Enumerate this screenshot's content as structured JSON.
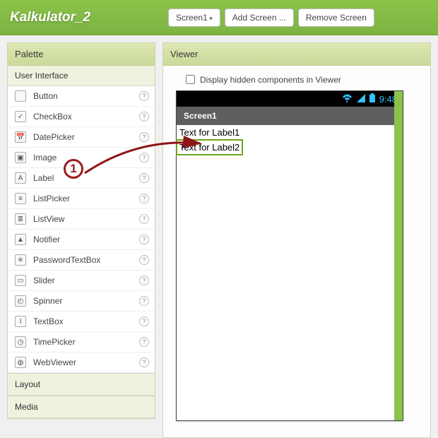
{
  "topbar": {
    "app_title": "Kalkulator_2",
    "screen_btn": "Screen1",
    "add_screen": "Add Screen ...",
    "remove_screen": "Remove Screen"
  },
  "palette": {
    "header": "Palette",
    "ui_header": "User Interface",
    "items": [
      {
        "label": "Button",
        "glyph": ""
      },
      {
        "label": "CheckBox",
        "glyph": "✓"
      },
      {
        "label": "DatePicker",
        "glyph": "📅"
      },
      {
        "label": "Image",
        "glyph": "▣"
      },
      {
        "label": "Label",
        "glyph": "A"
      },
      {
        "label": "ListPicker",
        "glyph": "≡"
      },
      {
        "label": "ListView",
        "glyph": "≣"
      },
      {
        "label": "Notifier",
        "glyph": "▲"
      },
      {
        "label": "PasswordTextBox",
        "glyph": "✳"
      },
      {
        "label": "Slider",
        "glyph": "▭"
      },
      {
        "label": "Spinner",
        "glyph": "◴"
      },
      {
        "label": "TextBox",
        "glyph": "I"
      },
      {
        "label": "TimePicker",
        "glyph": "◷"
      },
      {
        "label": "WebViewer",
        "glyph": "◍"
      }
    ],
    "layout_header": "Layout",
    "media_header": "Media"
  },
  "viewer": {
    "header": "Viewer",
    "hidden_label": "Display hidden components in Viewer",
    "status_time": "9:48",
    "screen_title": "Screen1",
    "label1": "Text for Label1",
    "label2": "Text for Label2"
  },
  "annotation": {
    "number": "1"
  }
}
